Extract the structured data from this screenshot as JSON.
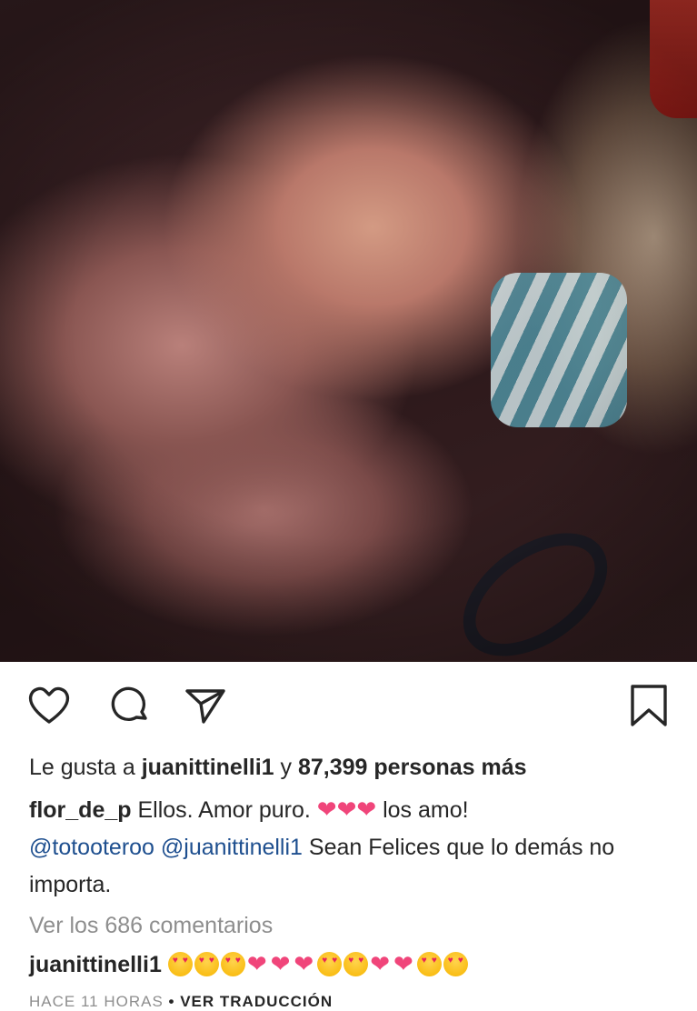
{
  "post": {
    "image_alt": "",
    "likes": {
      "prefix": "Le gusta a ",
      "user": "juanittinelli1",
      "middle": " y ",
      "count_text": "87,399 personas más"
    },
    "caption": {
      "author": "flor_de_p",
      "text_1": " Ellos. Amor puro. ",
      "hearts": "❤❤❤",
      "text_2": " los amo!",
      "mention_1": "@totooteroo",
      "mention_2": "@juanittinelli1",
      "text_3": " Sean Felices que lo demás no importa."
    },
    "view_comments": "Ver los 686 comentarios",
    "comment": {
      "user": "juanittinelli1",
      "emoji_sequence": [
        "smiling-face-with-heart-eyes",
        "smiling-face-with-heart-eyes",
        "smiling-face-with-heart-eyes",
        "red-heart",
        "red-heart",
        "red-heart",
        "smiling-face-with-heart-eyes",
        "smiling-face-with-heart-eyes",
        "red-heart",
        "red-heart",
        "smiling-face-with-heart-eyes",
        "smiling-face-with-heart-eyes"
      ]
    },
    "timestamp": "HACE 11 HORAS",
    "separator": "•",
    "translate": "VER TRADUCCIÓN"
  },
  "icons": {
    "like": "heart-outline-icon",
    "comment": "comment-bubble-icon",
    "share": "paper-plane-icon",
    "save": "bookmark-icon"
  },
  "colors": {
    "text": "#262626",
    "muted": "#8e8e8e",
    "mention": "#1e4f8f",
    "heart": "#f0457a"
  }
}
